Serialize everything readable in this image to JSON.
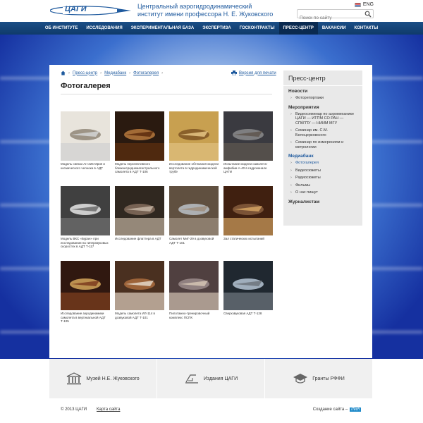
{
  "header": {
    "org_name": "Центральный аэрогидродинамический институт имени профессора Н. Е. Жуковского",
    "lang": "ENG",
    "search_placeholder": "Поиск по сайту",
    "logo_text": "ЦАГИ"
  },
  "nav": {
    "items": [
      "ОБ ИНСТИТУТЕ",
      "ИССЛЕДОВАНИЯ",
      "ЭКСПЕРИМЕНТАЛЬНАЯ БАЗА",
      "ЭКСПЕРТИЗА",
      "ГОСКОНТРАКТЫ",
      "ПРЕСС-ЦЕНТР",
      "ВАКАНСИИ",
      "КОНТАКТЫ"
    ],
    "active": 5
  },
  "breadcrumb": [
    "Пресс-центр",
    "Медиабанк",
    "Фотогалерея"
  ],
  "print_label": "Версия для печати",
  "page_title": "Фотогалерея",
  "photos": [
    {
      "caption": "Модель связки Ан-225 Мрия и космического челнока в АДТ"
    },
    {
      "caption": "Модель перспективного ближнесреднемагистрального самолета в АДТ Т-106"
    },
    {
      "caption": "Исследование обтекания модели вертолета в гидродинамической трубе"
    },
    {
      "caption": "Испытание модели самолета-амфибии А-40 в гидроканале ЦАГИ"
    },
    {
      "caption": "Модель ВКС «Буран» при исследовании на гиперзвуковых скоростях в АДТ Т-117"
    },
    {
      "caption": "Исследование флаттера в АДТ"
    },
    {
      "caption": "Самолет МиГ-29 в дозвуковой АДТ Т-101"
    },
    {
      "caption": "Зал статических испытаний"
    },
    {
      "caption": "Исследование аэродинамики самолета в вертикальной АДТ Т-105"
    },
    {
      "caption": "Модель самолета ИЛ-114 в дозвуковой АДТ Т-101"
    },
    {
      "caption": "Пилотажно-тренировочный комплекс ПСПК"
    },
    {
      "caption": "Сверхзвуковая АДТ Т-128"
    }
  ],
  "sidebar": {
    "title": "Пресс-центр",
    "sections": [
      {
        "heading": "Новости",
        "items": [
          "Фоторепортажи"
        ]
      },
      {
        "heading": "Мероприятия",
        "items": [
          "Видеосеминар по аэромеханике ЦАГИ — ИТПМ СО РАН — СПбГПУ — НИИМ МГУ",
          "Семинар им. С.М. Белоцерковского",
          "Семинар по измерениям и метрологии"
        ]
      },
      {
        "heading": "Медиабанк",
        "items": [
          "Фотогалерея",
          "Видеосюжеты",
          "Радиосюжеты",
          "Фильмы",
          "О нас пишут"
        ]
      },
      {
        "heading": "Журналистам",
        "items": []
      }
    ]
  },
  "promo": [
    "Музей Н.Е. Жуковского",
    "Издания ЦАГИ",
    "Гранты РФФИ"
  ],
  "footer": {
    "copyright": "© 2013 ЦАГИ",
    "sitemap": "Карта сайта",
    "made_by": "Создание сайта –",
    "made_badge": "iTech"
  },
  "colors": {
    "accent": "#1f5a9e",
    "nav": "#1b4e86"
  }
}
